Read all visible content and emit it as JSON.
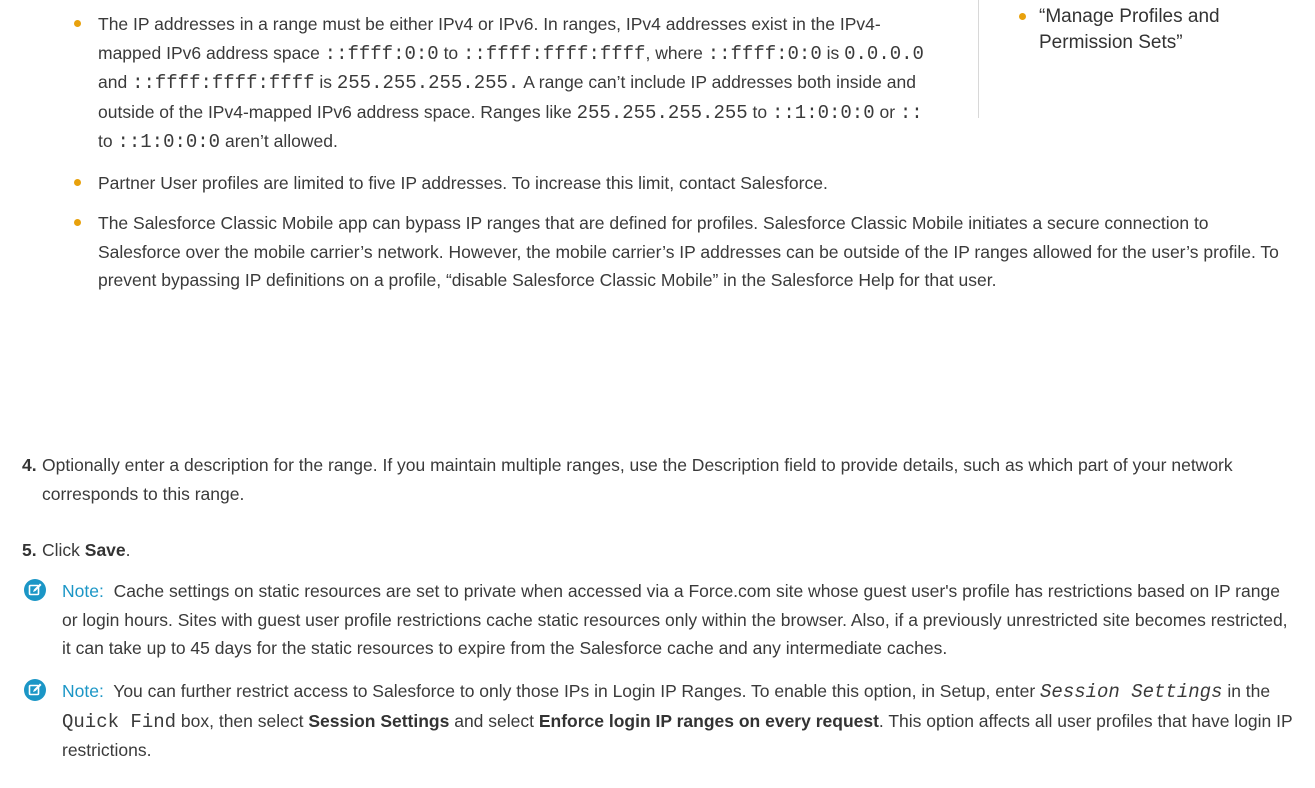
{
  "colors": {
    "bullet": "#e8a10c",
    "note_accent": "#1b96c6",
    "text": "#3a3a3a",
    "divider": "#d8d8d8"
  },
  "sidebar": {
    "items": [
      "“Manage Profiles and Permission Sets”"
    ]
  },
  "bullets": {
    "ip_ranges": {
      "t1": "The IP addresses in a range must be either IPv4 or IPv6. In ranges, IPv4 addresses exist in the IPv4-mapped IPv6 address space ",
      "c1": "::ffff:0:0",
      "t2": " to ",
      "c2": "::ffff:ffff:ffff",
      "t3": ", where ",
      "c3": "::ffff:0:0",
      "t4": " is ",
      "c4": "0.0.0.0",
      "t5": " and ",
      "c5": "::ffff:ffff:ffff",
      "t6": " is ",
      "c6": "255.255.255.255.",
      "t7": " A range can’t include IP addresses both inside and outside of the IPv4-mapped IPv6 address space. Ranges like ",
      "c7": "255.255.255.255",
      "t8": " to ",
      "c8": "::1:0:0:0",
      "t9": " or ",
      "c9": "::",
      "t10": " to ",
      "c10": "::1:0:0:0",
      "t11": " aren’t allowed."
    },
    "partner": "Partner User profiles are limited to five IP addresses. To increase this limit, contact Salesforce.",
    "mobile": "The Salesforce Classic Mobile app can bypass IP ranges that are defined for profiles. Salesforce Classic Mobile initiates a secure connection to Salesforce over the mobile carrier’s network. However, the mobile carrier’s IP addresses can be outside of the IP ranges allowed for the user’s profile. To prevent bypassing IP definitions on a profile, “disable Salesforce Classic Mobile” in the Salesforce Help for that user."
  },
  "steps": {
    "step4": {
      "number": "4.",
      "text": "Optionally enter a description for the range. If you maintain multiple ranges, use the Description field to provide details, such as which part of your network corresponds to this range."
    },
    "step5": {
      "number": "5.",
      "text_before": "Click ",
      "bold": "Save",
      "text_after": "."
    }
  },
  "notes": {
    "icon": "note-edit-icon",
    "note1": {
      "label": "Note:",
      "text": "Cache settings on static resources are set to private when accessed via a Force.com site whose guest user's profile has restrictions based on IP range or login hours. Sites with guest user profile restrictions cache static resources only within the browser. Also, if a previously unrestricted site becomes restricted, it can take up to 45 days for the static resources to expire from the Salesforce cache and any intermediate caches."
    },
    "note2": {
      "label": "Note:",
      "t1": "You can further restrict access to Salesforce to only those IPs in Login IP Ranges. To enable this option, in Setup, enter ",
      "code_italic": "Session Settings",
      "t2": " in the ",
      "code": "Quick Find",
      "t3": " box, then select ",
      "b1": "Session Settings",
      "t4": " and select ",
      "b2": "Enforce login IP ranges on every request",
      "t5": ". This option affects all user profiles that have login IP restrictions."
    }
  }
}
